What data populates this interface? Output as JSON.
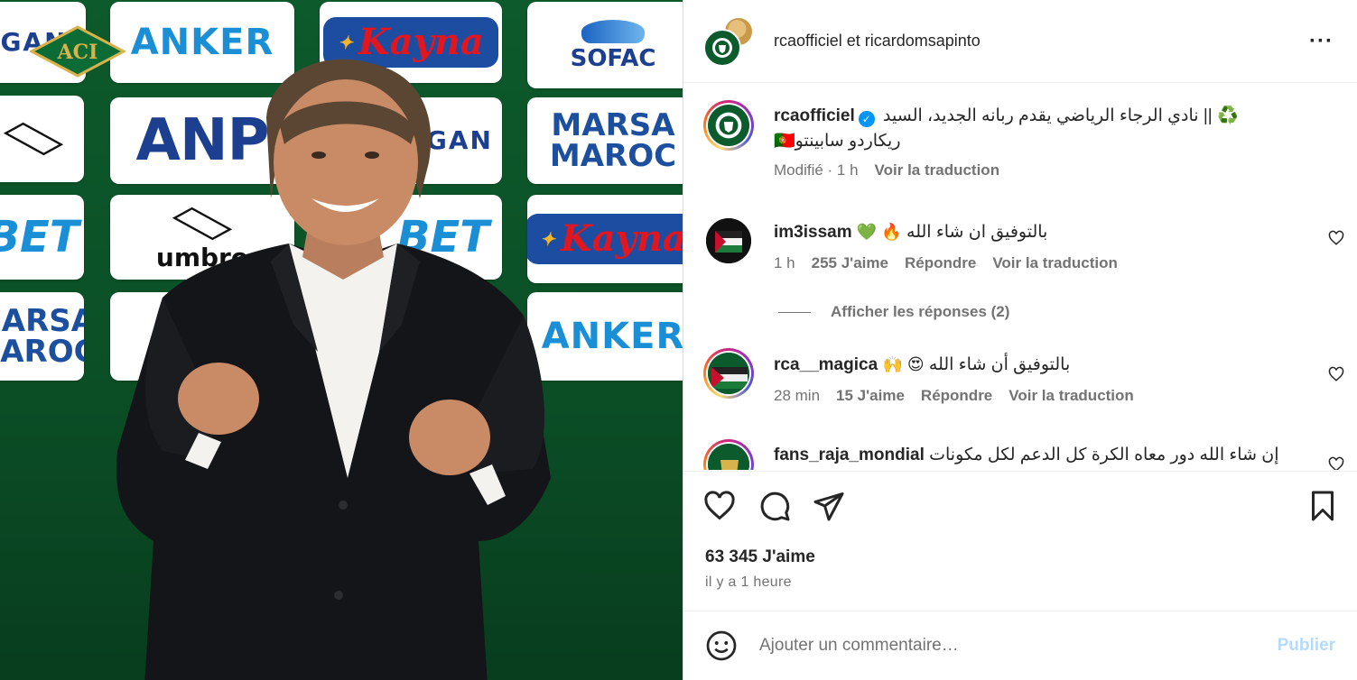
{
  "photo": {
    "sponsors": {
      "gan": "GAN",
      "anker": "ANKER",
      "kayna": "Kayna",
      "sofac": "SOFAC",
      "anp": "ANP",
      "marsa_top": "MARSA",
      "marsa_bottom": "MAROC",
      "bet": "BET",
      "umbro": "umbro"
    },
    "aci_logo": "ACI"
  },
  "header": {
    "user1": "rcaofficiel",
    "connector": "et",
    "user2": "ricardomsapinto",
    "more_icon": "more-horizontal-icon"
  },
  "caption": {
    "username": "rcaofficiel",
    "text_line1": "♻️ || نادي الرجاء الرياضي يقدم ربانه الجديد، السيد",
    "text_line2": "ريكاردو سابينتو🇵🇹",
    "modified": "Modifié · 1 h",
    "translate": "Voir la traduction"
  },
  "comments": [
    {
      "username": "im3issam",
      "text": "بالتوفيق ان شاء الله",
      "emojis": "💚 🔥",
      "time": "1 h",
      "likes": "255 J'aime",
      "reply": "Répondre",
      "translate": "Voir la traduction"
    },
    {
      "username": "rca__magica",
      "text": "بالتوفيق أن شاء الله",
      "emojis": "🙌 😍",
      "time": "28 min",
      "likes": "15 J'aime",
      "reply": "Répondre",
      "translate": "Voir la traduction"
    },
    {
      "username": "fans_raja_mondial",
      "text": "إن شاء الله دور معاه الكرة كل الدعم لكل مكونات"
    }
  ],
  "replies_toggle": "Afficher les réponses (2)",
  "actions": {
    "likes": "63 345 J'aime",
    "time_ago": "il y a 1 heure"
  },
  "composer": {
    "placeholder": "Ajouter un commentaire…",
    "publish": "Publier"
  },
  "colors": {
    "accent": "#0095f6",
    "publish_disabled": "#b3dbff",
    "backdrop_green": "#0b4f26"
  }
}
